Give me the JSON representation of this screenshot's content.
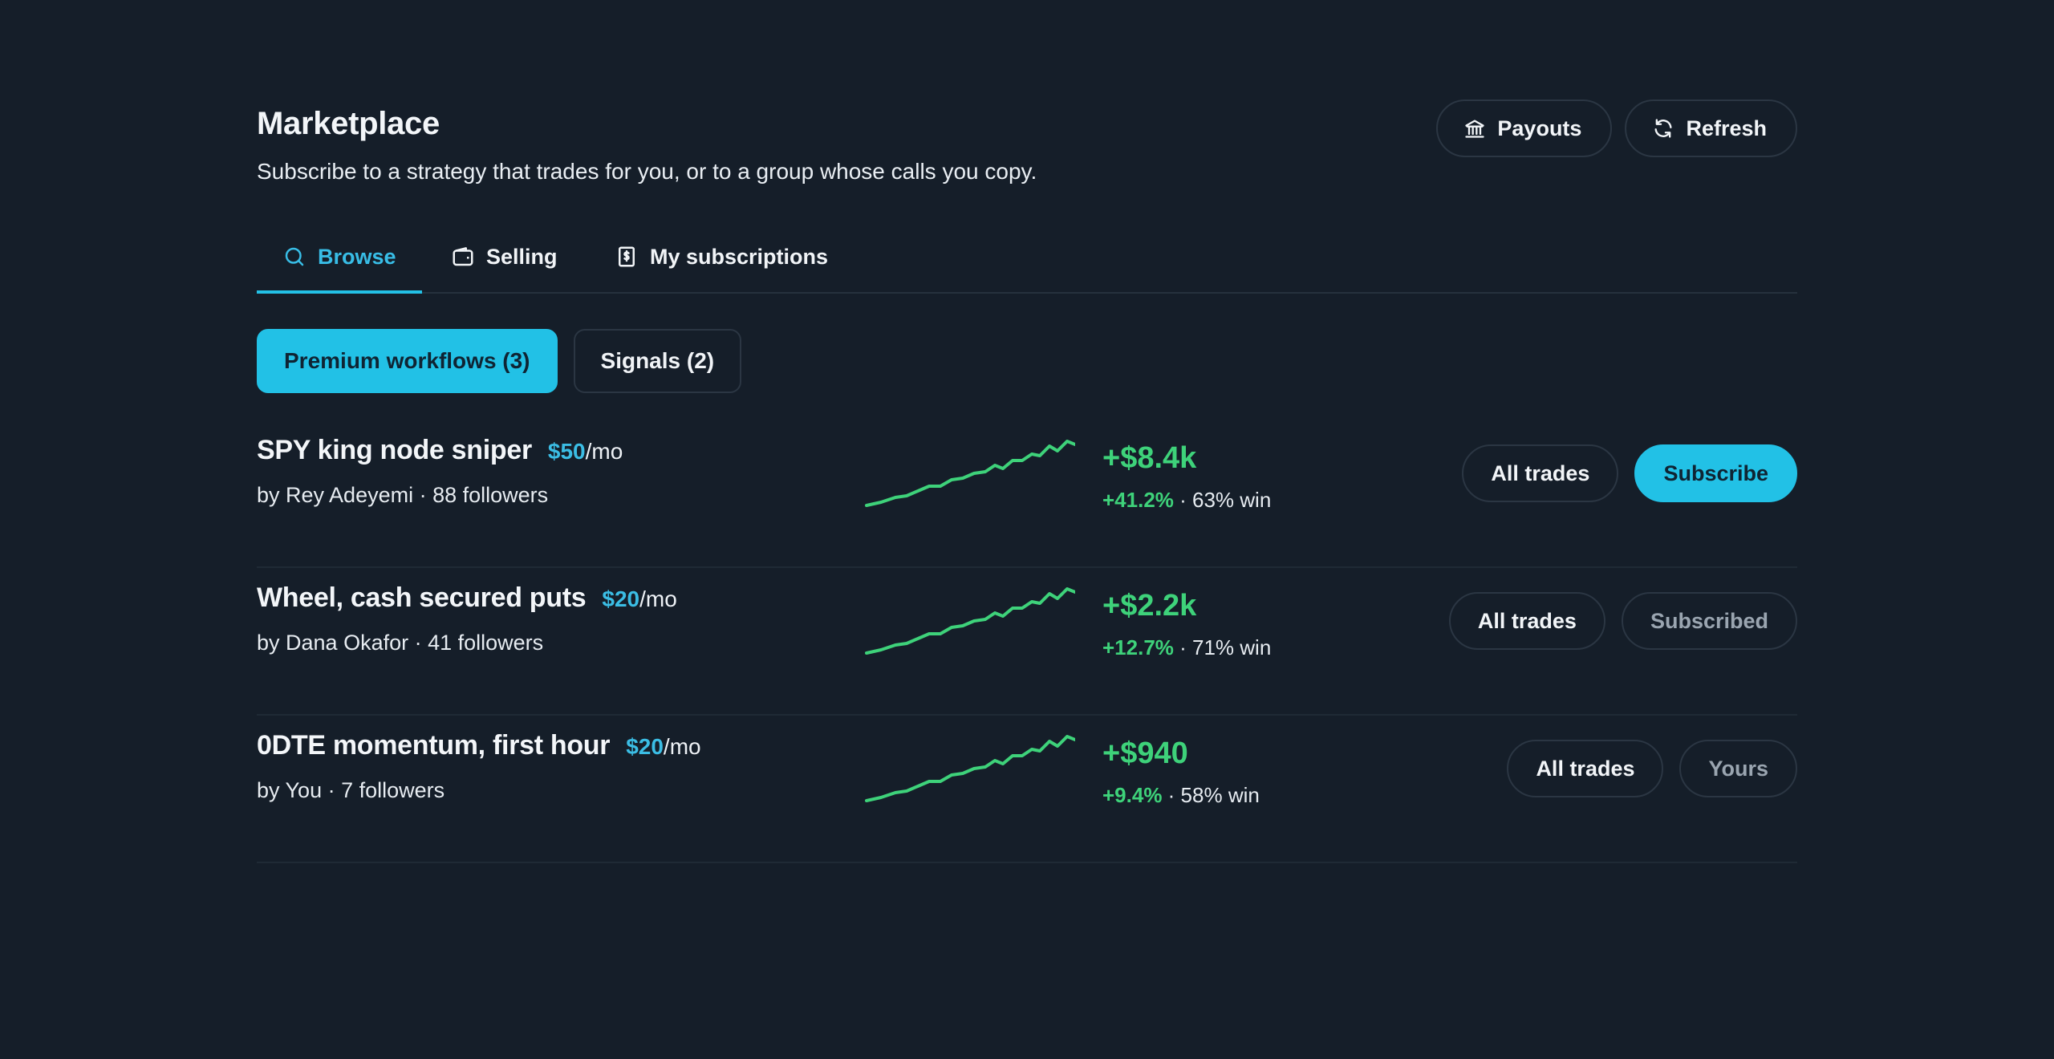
{
  "header": {
    "title": "Marketplace",
    "subtitle": "Subscribe to a strategy that trades for you, or to a group whose calls you copy.",
    "payouts_label": "Payouts",
    "refresh_label": "Refresh"
  },
  "tabs": [
    {
      "label": "Browse",
      "icon": "search-icon",
      "active": true
    },
    {
      "label": "Selling",
      "icon": "wallet-icon",
      "active": false
    },
    {
      "label": "My subscriptions",
      "icon": "receipt-icon",
      "active": false
    }
  ],
  "filters": [
    {
      "label": "Premium workflows (3)",
      "active": true
    },
    {
      "label": "Signals (2)",
      "active": false
    }
  ],
  "strategies": [
    {
      "name": "SPY king node sniper",
      "price": "$50",
      "per": "/mo",
      "byline": "by Rey Adeyemi · 88 followers",
      "pnl": "+$8.4k",
      "pct": "+41.2%",
      "win": " · 63% win",
      "all_trades_label": "All trades",
      "action_label": "Subscribe",
      "action_state": "primary"
    },
    {
      "name": "Wheel, cash secured puts",
      "price": "$20",
      "per": "/mo",
      "byline": "by Dana Okafor · 41 followers",
      "pnl": "+$2.2k",
      "pct": "+12.7%",
      "win": " · 71% win",
      "all_trades_label": "All trades",
      "action_label": "Subscribed",
      "action_state": "muted"
    },
    {
      "name": "0DTE momentum, first hour",
      "price": "$20",
      "per": "/mo",
      "byline": "by You · 7 followers",
      "pnl": "+$940",
      "pct": "+9.4%",
      "win": " · 58% win",
      "all_trades_label": "All trades",
      "action_label": "Yours",
      "action_state": "muted"
    }
  ],
  "colors": {
    "background": "#151e29",
    "accent": "#22c1e6",
    "positive": "#3ed27a"
  }
}
